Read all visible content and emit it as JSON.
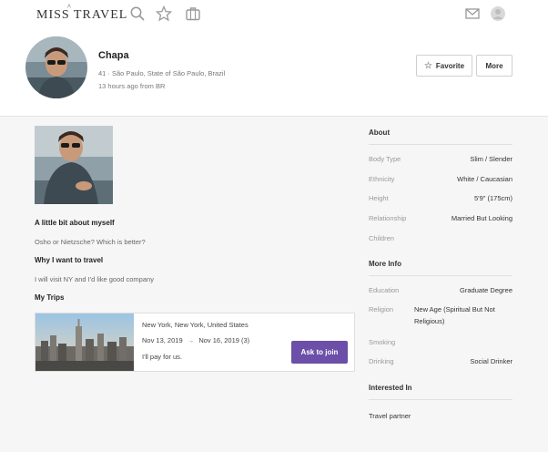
{
  "nav": {
    "logo": "MISS TRAVEL",
    "icons": [
      "search-icon",
      "star-icon",
      "suitcase-icon",
      "mail-icon",
      "user-avatar-icon"
    ]
  },
  "profile": {
    "name": "Chapa",
    "location": "41 · São Paulo, State of São Paulo, Brazil",
    "last_seen": "13 hours ago from BR",
    "favorite_label": "Favorite",
    "more_label": "More"
  },
  "main": {
    "about_title": "A little bit about myself",
    "about_text": "Osho or Nietzsche? Which is better?",
    "why_title": "Why I want to travel",
    "why_text": "I will visit NY and I'd like good company",
    "trips_title": "My Trips",
    "trip": {
      "destination": "New York, New York, United States",
      "date_from": "Nov 13, 2019",
      "arrow": "→",
      "date_to": "Nov 16, 2019 (3)",
      "payment": "I'll pay for us.",
      "join_label": "Ask to join"
    }
  },
  "side": {
    "about_head": "About",
    "about": [
      {
        "key": "Body Type",
        "value": "Slim / Slender"
      },
      {
        "key": "Ethnicity",
        "value": "White / Caucasian"
      },
      {
        "key": "Height",
        "value": "5'9\" (175cm)"
      },
      {
        "key": "Relationship",
        "value": "Married But Looking"
      },
      {
        "key": "Children",
        "value": ""
      }
    ],
    "more_head": "More Info",
    "more": [
      {
        "key": "Education",
        "value": "Graduate Degree"
      },
      {
        "key": "Religion",
        "value": "New Age (Spiritual But Not Religious)"
      },
      {
        "key": "Smoking",
        "value": ""
      },
      {
        "key": "Drinking",
        "value": "Social Drinker"
      }
    ],
    "interested_head": "Interested In",
    "interested_value": "Travel partner"
  },
  "colors": {
    "accent": "#6b4fa8",
    "page_bg": "#f6f6f6"
  }
}
